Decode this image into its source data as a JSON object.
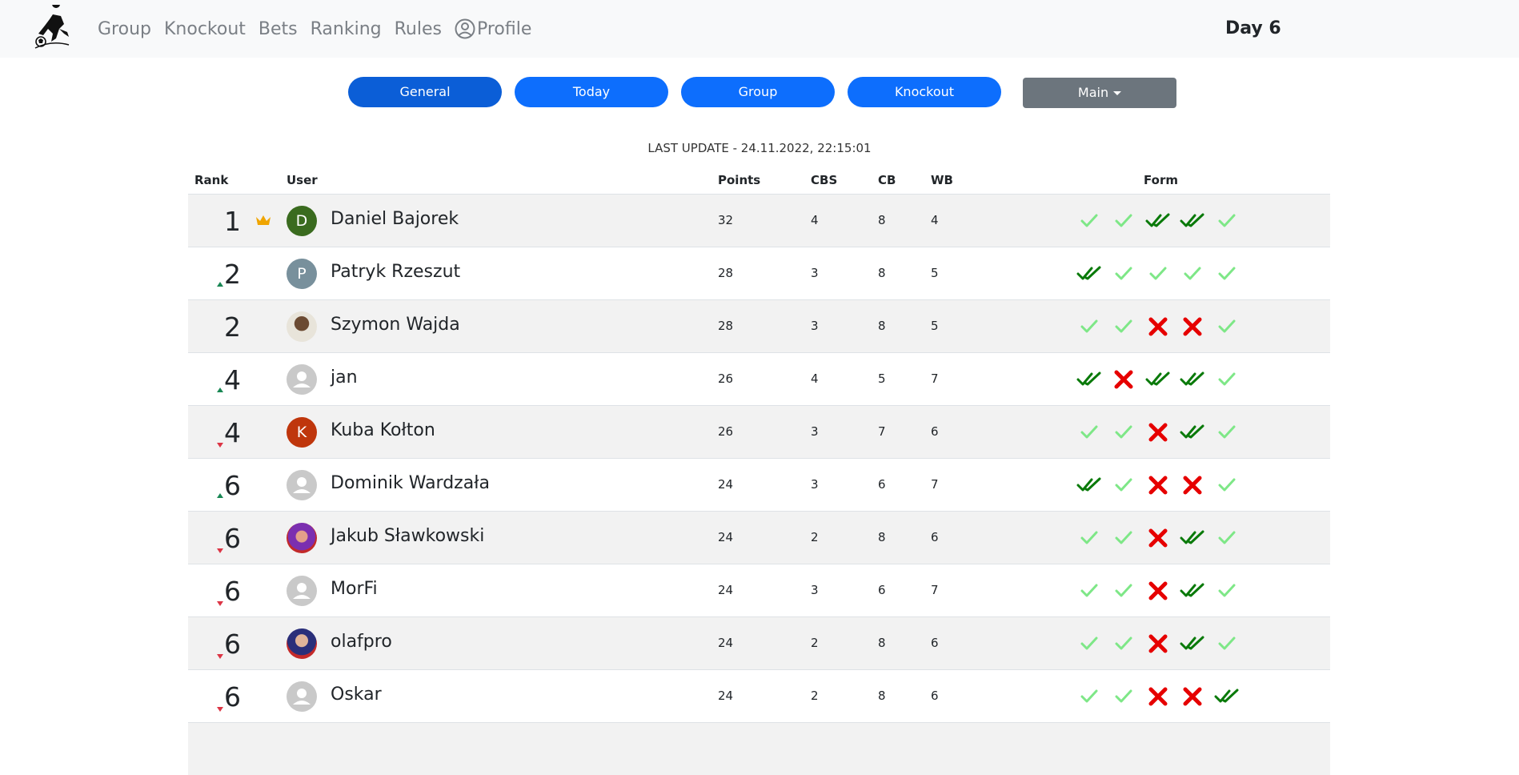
{
  "nav": {
    "links": [
      "Group",
      "Knockout",
      "Bets",
      "Ranking",
      "Rules",
      "Profile"
    ],
    "day": "Day 6"
  },
  "filters": [
    "General",
    "Today",
    "Group",
    "Knockout"
  ],
  "dropdown": "Main",
  "last_update": "LAST UPDATE - 24.11.2022, 22:15:01",
  "table": {
    "headers": [
      "Rank",
      "User",
      "Points",
      "CBS",
      "CB",
      "WB",
      "Form"
    ],
    "rows": [
      {
        "rank": "1",
        "change": "none",
        "crown": true,
        "avatar": "D",
        "avatar_color": "#3a6b1f",
        "name": "Daniel Bajorek",
        "points": "32",
        "cbs": "4",
        "cb": "8",
        "wb": "4",
        "form": [
          "light",
          "light",
          "double",
          "double",
          "light"
        ]
      },
      {
        "rank": "2",
        "change": "up",
        "crown": false,
        "avatar": "P",
        "avatar_color": "#78909c",
        "name": "Patryk Rzeszut",
        "points": "28",
        "cbs": "3",
        "cb": "8",
        "wb": "5",
        "form": [
          "double",
          "light",
          "light",
          "light",
          "light"
        ]
      },
      {
        "rank": "2",
        "change": "none",
        "crown": false,
        "avatar": "photo1",
        "avatar_color": "",
        "name": "Szymon Wajda",
        "points": "28",
        "cbs": "3",
        "cb": "8",
        "wb": "5",
        "form": [
          "light",
          "light",
          "cross",
          "cross",
          "light"
        ]
      },
      {
        "rank": "4",
        "change": "up",
        "crown": false,
        "avatar": "blank",
        "avatar_color": "",
        "name": "jan",
        "points": "26",
        "cbs": "4",
        "cb": "5",
        "wb": "7",
        "form": [
          "double",
          "cross",
          "double",
          "double",
          "light"
        ]
      },
      {
        "rank": "4",
        "change": "down",
        "crown": false,
        "avatar": "K",
        "avatar_color": "#bf360c",
        "name": "Kuba Kołton",
        "points": "26",
        "cbs": "3",
        "cb": "7",
        "wb": "6",
        "form": [
          "light",
          "light",
          "cross",
          "double",
          "light"
        ]
      },
      {
        "rank": "6",
        "change": "up",
        "crown": false,
        "avatar": "blank",
        "avatar_color": "",
        "name": "Dominik Wardzała",
        "points": "24",
        "cbs": "3",
        "cb": "6",
        "wb": "7",
        "form": [
          "double",
          "light",
          "cross",
          "cross",
          "light"
        ]
      },
      {
        "rank": "6",
        "change": "down",
        "crown": false,
        "avatar": "photo2",
        "avatar_color": "",
        "name": "Jakub Sławkowski",
        "points": "24",
        "cbs": "2",
        "cb": "8",
        "wb": "6",
        "form": [
          "light",
          "light",
          "cross",
          "double",
          "light"
        ]
      },
      {
        "rank": "6",
        "change": "down",
        "crown": false,
        "avatar": "blank",
        "avatar_color": "",
        "name": "MorFi",
        "points": "24",
        "cbs": "3",
        "cb": "6",
        "wb": "7",
        "form": [
          "light",
          "light",
          "cross",
          "double",
          "light"
        ]
      },
      {
        "rank": "6",
        "change": "down",
        "crown": false,
        "avatar": "photo3",
        "avatar_color": "",
        "name": "olafpro",
        "points": "24",
        "cbs": "2",
        "cb": "8",
        "wb": "6",
        "form": [
          "light",
          "light",
          "cross",
          "double",
          "light"
        ]
      },
      {
        "rank": "6",
        "change": "down",
        "crown": false,
        "avatar": "blank",
        "avatar_color": "",
        "name": "Oskar",
        "points": "24",
        "cbs": "2",
        "cb": "8",
        "wb": "6",
        "form": [
          "light",
          "light",
          "cross",
          "cross",
          "double"
        ]
      }
    ]
  },
  "colors": {
    "primary": "#0d6efd",
    "primary_active": "#0b5ed7",
    "secondary": "#6c757d",
    "check_light": "#7ee787",
    "check_dark": "#0a7a0a",
    "cross": "#e60000",
    "crown": "#f0a500"
  }
}
